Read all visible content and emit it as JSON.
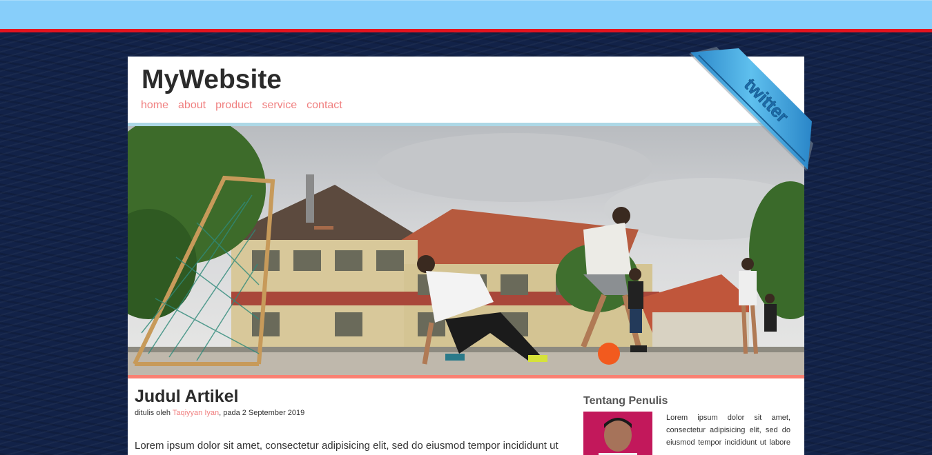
{
  "site": {
    "title": "MyWebsite"
  },
  "nav": [
    "home",
    "about",
    "product",
    "service",
    "contact"
  ],
  "ribbon": {
    "label": "twitter"
  },
  "article": {
    "title": "Judul Artikel",
    "meta_prefix": "ditulis oleh ",
    "author": "Taqiyyan Iyan",
    "meta_suffix": ", pada 2 September 2019",
    "body": "Lorem ipsum dolor sit amet, consectetur adipisicing elit, sed do eiusmod tempor incididunt ut"
  },
  "sidebar": {
    "heading": "Tentang Penulis",
    "text": "Lorem ipsum dolor sit amet, consectetur adipisicing elit, sed do eiusmod tempor incididunt ut labore et dolore magna aliqua. Ut enim ad"
  },
  "colors": {
    "topbar": "#87cefa",
    "redline": "#e5141f",
    "link": "#f08080",
    "hero_border": "#fa8072",
    "header_border": "#add8e6"
  }
}
